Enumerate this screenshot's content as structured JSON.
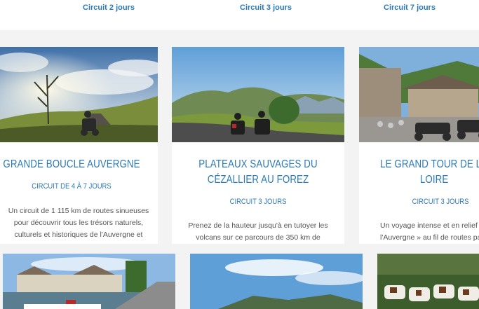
{
  "top_links": [
    {
      "label": "Circuit 2 jours"
    },
    {
      "label": "Circuit 3 jours"
    },
    {
      "label": "Circuit 7 jours"
    }
  ],
  "cards": [
    {
      "title": "GRANDE BOUCLE AUVERGNE",
      "subtitle": "CIRCUIT DE 4 À 7 JOURS",
      "desc_lines": [
        "Un circuit de 1 115 km de routes sinueuses",
        "pour découvrir tous les trésors naturels,",
        "culturels et historiques de l'Auvergne et",
        "..."
      ]
    },
    {
      "title_lines": [
        "PLATEAUX SAUVAGES DU",
        "CÉZALLIER AU FOREZ"
      ],
      "subtitle": "CIRCUIT 3 JOURS",
      "desc_lines": [
        "Prenez de la hauteur jusqu'à en tutoyer les",
        "volcans sur ce parcours de 350 km de"
      ]
    },
    {
      "title_lines": [
        "LE GRAND TOUR DE LA HAUTE-",
        "LOIRE"
      ],
      "subtitle": "CIRCUIT 3 JOURS",
      "desc_lines": [
        "Un voyage intense et en relief du Puy-en-",
        "l'Auvergne » au fil de routes par"
      ]
    }
  ],
  "colors": {
    "accent": "#2b7ab8",
    "background": "#f3f3f3",
    "card": "#ffffff",
    "text": "#555555"
  }
}
